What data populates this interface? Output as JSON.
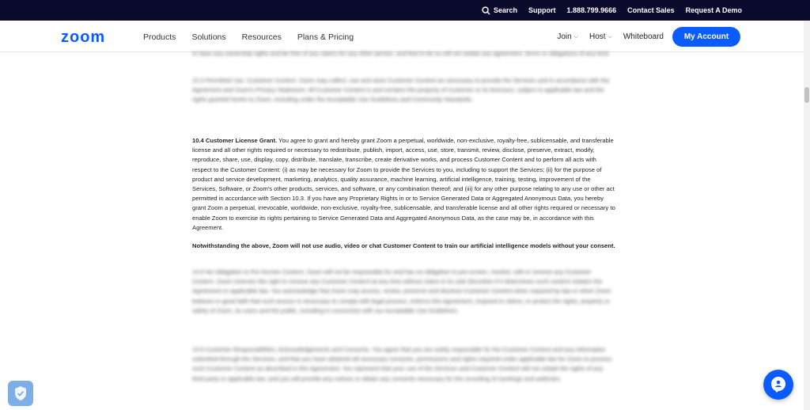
{
  "colors": {
    "topbar_bg": "#0b0b2e",
    "brand": "#0b5cff",
    "widget": "#7eaee8"
  },
  "topbar": {
    "search": "Search",
    "support": "Support",
    "phone": "1.888.799.9666",
    "contact_sales": "Contact Sales",
    "request_demo": "Request A Demo"
  },
  "nav": {
    "logo": "zoom",
    "links": [
      "Products",
      "Solutions",
      "Resources",
      "Plans & Pricing"
    ],
    "join": "Join",
    "host": "Host",
    "whiteboard": "Whiteboard",
    "my_account": "My Account"
  },
  "content": {
    "blur_top": "to have any ownership rights and be free of any claims for any other person, and that to do so will not violate any agreement, terms or obligations of any kind.",
    "blur_1": "10.3 Permitted Use. Customer Content. Zoom may collect, use and store Customer Content as necessary to provide the Services and in accordance with the Agreement and Zoom's Privacy Statement. All Customer Content is and remains the property of Customer or its licensors, subject to applicable law and the rights granted herein to Zoom, including under the Acceptable Use Guidelines and Community Standards.",
    "para1_title": "10.4 Customer License Grant.",
    "para1_text": " You agree to grant and hereby grant Zoom a perpetual, worldwide, non-exclusive, royalty-free, sublicensable, and transferable license and all other rights required or necessary to redistribute, publish, import, access, use, store, transmit, review, disclose, preserve, extract, modify, reproduce, share, use, display, copy, distribute, translate, transcribe, create derivative works, and process Customer Content and to perform all acts with respect to the Customer Content: (i) as may be necessary for Zoom to provide the Services to you, including to support the Services; (ii) for the purpose of product and service development, marketing, analytics, quality assurance, machine learning, artificial intelligence, training, testing, improvement of the Services, Software, or Zoom's other products, services, and software, or any combination thereof; and (iii) for any other purpose relating to any use or other act permitted in accordance with Section 10.3. If you have any Proprietary Rights in or to Service Generated Data or Aggregated Anonymous Data, you hereby grant Zoom a perpetual, irrevocable, worldwide, non-exclusive, royalty-free, sublicensable, and transferable license and all other rights required or necessary to enable Zoom to exercise its rights pertaining to Service Generated Data and Aggregated Anonymous Data, as the case may be, in accordance with this Agreement.",
    "para2": "Notwithstanding the above, Zoom will not use audio, video or chat Customer Content to train our artificial intelligence models without your consent.",
    "blur_2": "10.5 No Obligation to Pre-Screen Content. Zoom will not be responsible for and has no obligation to pre-screen, monitor, edit or remove any Customer Content. Zoom reserves the right to remove any Customer Content at any time without notice in its sole discretion if it determines such content violates the Agreement or applicable law. You acknowledge that Zoom may access, review, preserve and disclose Customer Content when required by law or when Zoom believes in good faith that such access is necessary to comply with legal process, enforce this Agreement, respond to claims, or protect the rights, property or safety of Zoom, its users and the public, including in connection with our Acceptable Use Guidelines.",
    "blur_3": "10.6 Customer Responsibilities; Acknowledgements and Consents. You agree that you are solely responsible for the Customer Content and any information submitted through the Services, and that you have obtained all necessary consents, permissions and rights required under applicable law for Zoom to process such Customer Content as described in this Agreement. You represent that your use of the Services and Customer Content will not violate the rights of any third party or applicable law, and you will provide any notices or obtain any consents necessary for the recording of meetings and webinars."
  }
}
